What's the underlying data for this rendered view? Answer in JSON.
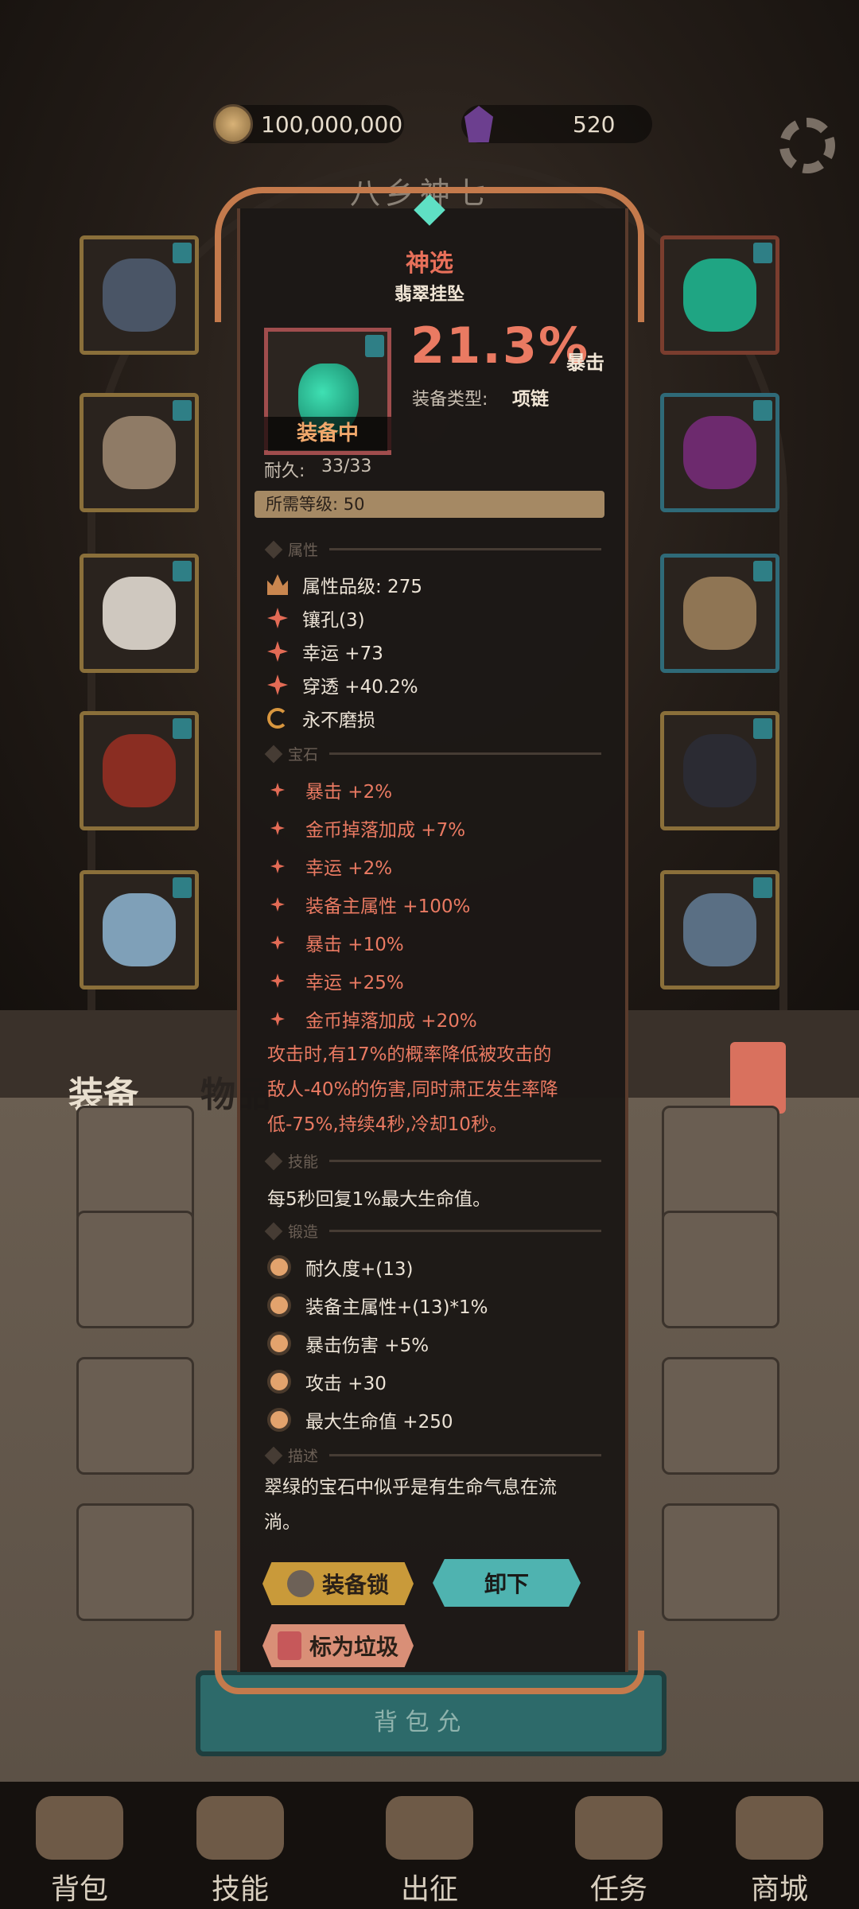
{
  "resources": {
    "gold": "100,000,000",
    "gems": "520"
  },
  "bg_title": "八乡神七",
  "bag_tabs": {
    "equip": "装备",
    "items": "物品"
  },
  "item": {
    "rarity": "神选",
    "name": "翡翠挂坠",
    "equipped_badge": "装备中",
    "main_stat_value": "21.3%",
    "main_stat_name": "暴击",
    "type_label": "装备类型:",
    "type_value": "项链",
    "durability_label": "耐久:",
    "durability_value": "33/33",
    "level_label": "所需等级:",
    "level_value": "50"
  },
  "sections": {
    "attributes": "属性",
    "gems": "宝石",
    "skill": "技能",
    "forge": "锻造",
    "description": "描述"
  },
  "attributes": [
    {
      "text": "属性品级: 275",
      "icon": "crown-icon"
    },
    {
      "text": "镶孔(3)",
      "icon": "star-icon"
    },
    {
      "text": "幸运 +73",
      "icon": "star-icon"
    },
    {
      "text": "穿透 +40.2%",
      "icon": "star-icon"
    },
    {
      "text": "永不磨损",
      "icon": "cycle-icon"
    }
  ],
  "gem_stats": [
    "暴击 +2%",
    "金币掉落加成 +7%",
    "幸运 +2%",
    "装备主属性 +100%",
    "暴击 +10%",
    "幸运 +25%",
    "金币掉落加成 +20%"
  ],
  "gem_effect": [
    "攻击时,有17%的概率降低被攻击的",
    "敌人-40%的伤害,同时肃正发生率降",
    "低-75%,持续4秒,冷却10秒。"
  ],
  "skill_text": "每5秒回复1%最大生命值。",
  "forge_stats": [
    "耐久度+(13)",
    "装备主属性+(13)*1%",
    "暴击伤害 +5%",
    "攻击 +30",
    "最大生命值 +250"
  ],
  "description_lines": [
    "翠绿的宝石中似乎是有生命气息在流",
    "淌。"
  ],
  "buttons": {
    "lock": "装备锁",
    "unequip": "卸下",
    "trash": "标为垃圾"
  },
  "behind_text": "背 包 允",
  "nav": [
    "背包",
    "技能",
    "出征",
    "任务",
    "商城"
  ],
  "colors": {
    "accent_red": "#ea7a62",
    "teal": "#4fb3b0",
    "gold": "#c99a3a"
  }
}
